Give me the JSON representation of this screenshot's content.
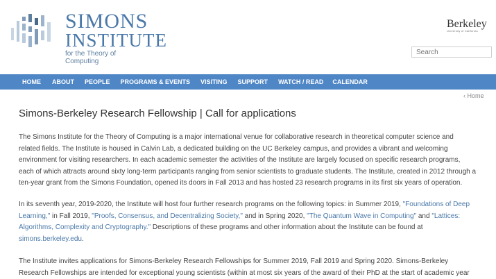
{
  "brand": {
    "line1": "SIMONS",
    "line2": "INSTITUTE",
    "line3": "for the Theory of Computing"
  },
  "berkeley": {
    "name": "Berkeley",
    "sub": "University of California"
  },
  "search": {
    "placeholder": "Search"
  },
  "nav": [
    "HOME",
    "ABOUT",
    "PEOPLE",
    "PROGRAMS & EVENTS",
    "VISITING",
    "SUPPORT",
    "WATCH / READ",
    "CALENDAR"
  ],
  "breadcrumb": {
    "home": "‹ Home"
  },
  "page": {
    "title": "Simons-Berkeley Research Fellowship | Call for applications",
    "p1": "The Simons Institute for the Theory of Computing is a major international venue for collaborative research in theoretical computer science and related fields. The Institute is housed in Calvin Lab, a dedicated building on the UC Berkeley campus, and provides a vibrant and welcoming environment for visiting researchers. In each academic semester the activities of the Institute are largely focused on specific research programs, each of which attracts around sixty long-term participants ranging from senior scientists to graduate students. The Institute, created in 2012 through a ten-year grant from the Simons Foundation, opened its doors in Fall 2013 and has hosted 23 research programs in its first six years of operation.",
    "p2": {
      "t1": "In its seventh year, 2019-2020, the Institute will host four further research programs on the following topics: in Summer 2019, ",
      "l1": "\"Foundations of Deep Learning,\"",
      "t2": " in Fall 2019, ",
      "l2": "\"Proofs, Consensus, and Decentralizing Society,\"",
      "t3": " and in Spring 2020, ",
      "l3": "\"The Quantum Wave in Computing\"",
      "t4": " and ",
      "l4": "\"Lattices: Algorithms, Complexity and Cryptography.\"",
      "t5": " Descriptions of these programs and other information about the Institute can be found at ",
      "l5": "simons.berkeley.edu",
      "t6": "."
    },
    "p3": "The Institute invites applications for Simons-Berkeley Research Fellowships for Summer 2019, Fall 2019 and Spring 2020. Simons-Berkeley Research Fellowships are intended for exceptional young scientists (within at most six years of the award of their PhD at the start of academic year"
  }
}
